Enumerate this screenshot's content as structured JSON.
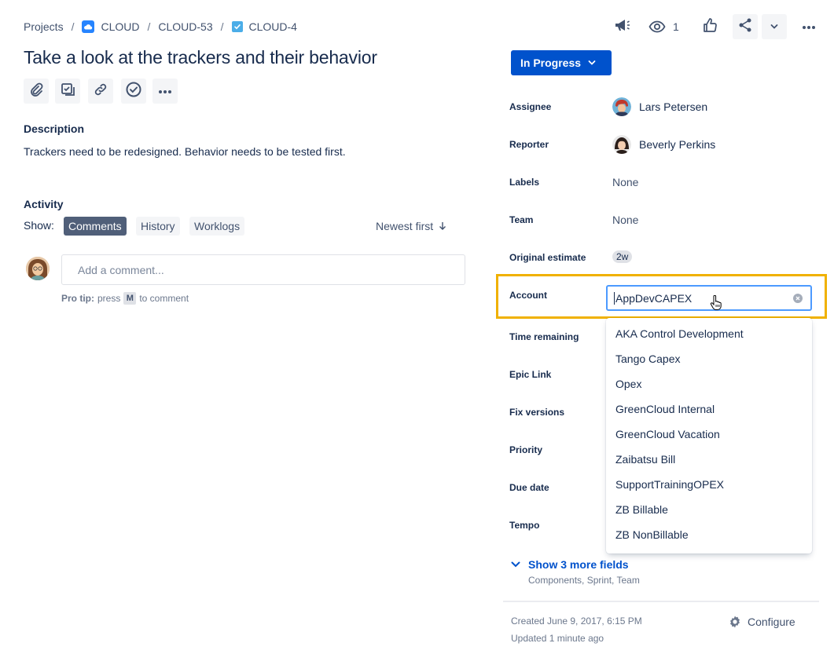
{
  "breadcrumb": {
    "projects": "Projects",
    "project": "CLOUD",
    "epic": "CLOUD-53",
    "issue": "CLOUD-4"
  },
  "issue": {
    "title": "Take a look at the trackers and their behavior",
    "description_heading": "Description",
    "description": "Trackers need to be redesigned. Behavior needs to be tested first."
  },
  "activity": {
    "heading": "Activity",
    "show_label": "Show:",
    "tabs": [
      "Comments",
      "History",
      "Worklogs"
    ],
    "active_tab": "Comments",
    "sort_label": "Newest first",
    "comment_placeholder": "Add a comment...",
    "protip_bold": "Pro tip:",
    "protip_press": "press",
    "protip_key": "M",
    "protip_rest": "to comment"
  },
  "header": {
    "watch_count": "1"
  },
  "status": {
    "label": "In Progress"
  },
  "fields": {
    "assignee": {
      "label": "Assignee",
      "value": "Lars Petersen"
    },
    "reporter": {
      "label": "Reporter",
      "value": "Beverly Perkins"
    },
    "labels": {
      "label": "Labels",
      "value": "None"
    },
    "team": {
      "label": "Team",
      "value": "None"
    },
    "original_estimate": {
      "label": "Original estimate",
      "value": "2w"
    },
    "account": {
      "label": "Account",
      "value": "AppDevCAPEX"
    },
    "time_remaining": {
      "label": "Time remaining"
    },
    "epic_link": {
      "label": "Epic Link"
    },
    "fix_versions": {
      "label": "Fix versions"
    },
    "priority": {
      "label": "Priority"
    },
    "due_date": {
      "label": "Due date"
    },
    "tempo": {
      "label": "Tempo"
    }
  },
  "account_options": [
    "AKA Control Development",
    "Tango Capex",
    "Opex",
    "GreenCloud Internal",
    "GreenCloud Vacation",
    "Zaibatsu Bill",
    "SupportTrainingOPEX",
    "ZB Billable",
    "ZB NonBillable"
  ],
  "more_fields": {
    "label": "Show 3 more fields",
    "sub": "Components, Sprint, Team"
  },
  "footer": {
    "created": "Created June 9, 2017, 6:15 PM",
    "updated": "Updated 1 minute ago",
    "configure": "Configure"
  },
  "colors": {
    "primary": "#0052CC",
    "highlight": "#F0B100",
    "focus_border": "#4C9AFF"
  }
}
